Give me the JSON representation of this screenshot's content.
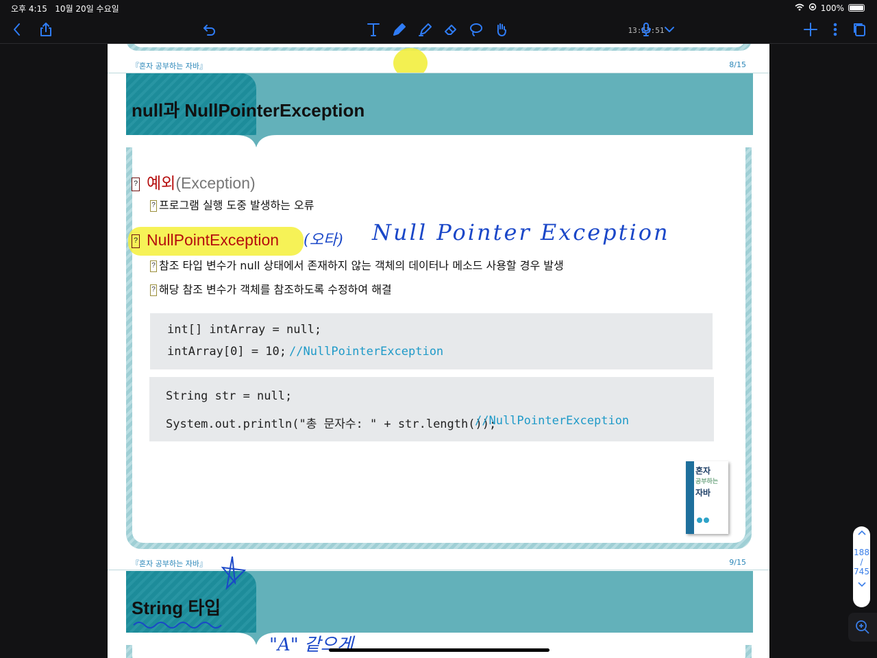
{
  "status": {
    "time": "오후 4:15",
    "date": "10월 20일 수요일",
    "battery": "100%"
  },
  "toolbar": {
    "clock": "13:53:51"
  },
  "page8": {
    "header_left": "『혼자 공부하는 자바』",
    "header_right": "8/15",
    "title": "null과 NullPointerException",
    "section1": {
      "marker": "?",
      "title_red": "예외",
      "title_gray": "(Exception)"
    },
    "section1_bullet": {
      "marker": "?",
      "text": "프로그램 실행 도중 발생하는 오류"
    },
    "section2": {
      "marker": "?",
      "title": "NullPointException"
    },
    "section2_bullets": [
      {
        "marker": "?",
        "text": "참조 타입 변수가 null 상태에서 존재하지 않는 객체의 데이터나 메소드 사용할 경우 발생"
      },
      {
        "marker": "?",
        "text": "해당 참조 변수가 객체를 참조하도록 수정하여 해결"
      }
    ],
    "code1": {
      "line1": "int[] intArray = null;",
      "line2": "intArray[0] = 10;",
      "comment": "//NullPointerException"
    },
    "code2": {
      "line1": "String str = null;",
      "line2": "System.out.println(\"총 문자수: \" + str.length());",
      "comment": "//NullPointerException"
    },
    "handwriting": {
      "note1": "(오타)",
      "note2": "Null Pointer Exception"
    }
  },
  "page9": {
    "header_left": "『혼자 공부하는 자바』",
    "header_right": "9/15",
    "title": "String 타입",
    "handwriting": "\"A\" 같으게"
  },
  "book_cover": {
    "line1": "혼자",
    "line2": "공부하는",
    "line3": "자바"
  },
  "page_indicator": {
    "current": "188",
    "sep": "/",
    "total": "745"
  },
  "colors": {
    "accent": "#2f7cf6",
    "teal": "#63b1ba",
    "red": "#b50d0d",
    "highlight": "#f5f03a"
  }
}
